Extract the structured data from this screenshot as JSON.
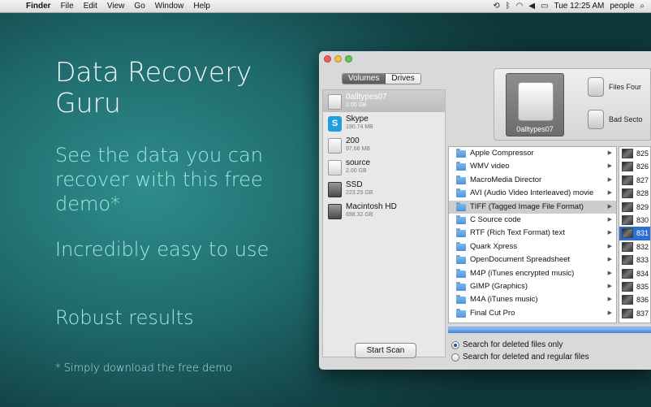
{
  "menubar": {
    "app": "Finder",
    "items": [
      "File",
      "Edit",
      "View",
      "Go",
      "Window",
      "Help"
    ],
    "clock": "Tue 12:25 AM",
    "user": "people"
  },
  "promo": {
    "title": "Data Recovery Guru",
    "sub1": "See the data you can recover with this free demo*",
    "sub2": "Incredibly easy to use",
    "sub3": "Robust results",
    "footnote": "* Simply download the free demo"
  },
  "app": {
    "tabs": [
      "Volumes",
      "Drives"
    ],
    "volumes": [
      {
        "name": "0alltypes07",
        "size": "2.00 GB",
        "icon": "disk-white",
        "selected": true
      },
      {
        "name": "Skype",
        "size": "190.74 MB",
        "icon": "skype",
        "selected": false
      },
      {
        "name": "200",
        "size": "97.66 MB",
        "icon": "disk-white",
        "selected": false
      },
      {
        "name": "source",
        "size": "2.00 GB",
        "icon": "disk-white",
        "selected": false
      },
      {
        "name": "SSD",
        "size": "223.25 GB",
        "icon": "disk-dark",
        "selected": false
      },
      {
        "name": "Macintosh HD",
        "size": "698.32 GB",
        "icon": "disk-dark",
        "selected": false
      }
    ],
    "start_scan": "Start Scan",
    "drive_label": "0alltypes07",
    "stat_files": "Files Four",
    "stat_bad": "Bad Secto",
    "files": [
      "Apple Compressor",
      "WMV video",
      "MacroMedia Director",
      "AVI (Audio Video Interleaved) movie",
      "TIFF (Tagged Image File Format)",
      "C Source code",
      "RTF (Rich Text Format) text",
      "Quark Xpress",
      "OpenDocument Spreadsheet",
      "M4P (iTunes encrypted music)",
      "GIMP (Graphics)",
      "M4A (iTunes music)",
      "Final Cut Pro"
    ],
    "selected_file_index": 4,
    "thumbs": [
      "825",
      "826",
      "827",
      "828",
      "829",
      "830",
      "831",
      "832",
      "833",
      "834",
      "835",
      "836",
      "837"
    ],
    "selected_thumb_index": 6,
    "options": [
      "Search for deleted files only",
      "Search for deleted and regular files"
    ],
    "selected_option": 0
  }
}
